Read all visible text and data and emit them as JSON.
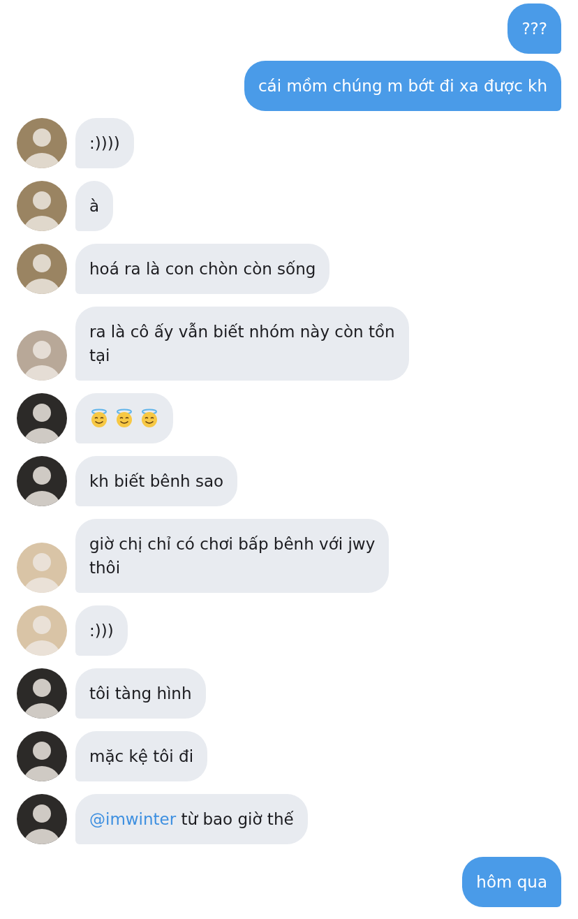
{
  "messages": [
    {
      "outgoing": true,
      "lines": [
        "???"
      ]
    },
    {
      "outgoing": true,
      "lines": [
        "cái mồm chúng m bớt đi xa được kh"
      ]
    },
    {
      "outgoing": false,
      "avatar": {
        "color": "#9a8462"
      },
      "lines": [
        ":))))"
      ]
    },
    {
      "outgoing": false,
      "avatar": {
        "color": "#9a8462"
      },
      "lines": [
        "à"
      ]
    },
    {
      "outgoing": false,
      "avatar": {
        "color": "#9a8462"
      },
      "lines": [
        "hoá ra là con chòn còn sống"
      ]
    },
    {
      "outgoing": false,
      "avatar": {
        "color": "#b8a898"
      },
      "lines": [
        "ra là cô ấy vẫn biết nhóm này còn tồn",
        "tại"
      ]
    },
    {
      "outgoing": false,
      "avatar": {
        "color": "#2c2a28"
      },
      "kind": "emoji",
      "icons": [
        {
          "kind": "halo-smile"
        },
        {
          "kind": "halo-smile"
        },
        {
          "kind": "halo-smile"
        }
      ]
    },
    {
      "outgoing": false,
      "avatar": {
        "color": "#2c2a28"
      },
      "lines": [
        "kh biết bênh sao"
      ]
    },
    {
      "outgoing": false,
      "avatar": {
        "color": "#d9c4a6"
      },
      "lines": [
        "giờ chị chỉ có chơi bấp bênh với jwy",
        "thôi"
      ]
    },
    {
      "outgoing": false,
      "avatar": {
        "color": "#d9c4a6"
      },
      "lines": [
        ":)))"
      ]
    },
    {
      "outgoing": false,
      "avatar": {
        "color": "#2c2a28"
      },
      "lines": [
        "tôi tàng hình"
      ]
    },
    {
      "outgoing": false,
      "avatar": {
        "color": "#2c2a28"
      },
      "lines": [
        "mặc kệ tôi đi"
      ]
    },
    {
      "outgoing": false,
      "avatar": {
        "color": "#2c2a28"
      },
      "mention": "@imwinter",
      "lines": [
        "từ bao giờ thế"
      ]
    },
    {
      "outgoing": true,
      "lines": [
        "hôm qua"
      ]
    }
  ]
}
